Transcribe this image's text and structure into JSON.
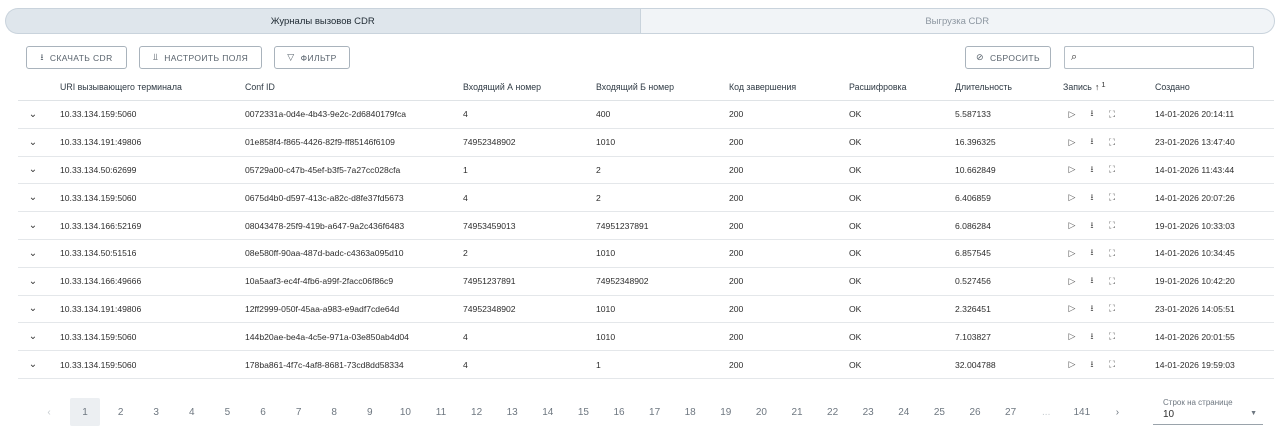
{
  "tabs": [
    {
      "label": "Журналы вызовов CDR",
      "active": true
    },
    {
      "label": "Выгрузка CDR",
      "active": false
    }
  ],
  "toolbar": {
    "download": {
      "label": "СКАЧАТЬ CDR",
      "icon": "download-icon"
    },
    "configure": {
      "label": "НАСТРОИТЬ ПОЛЯ",
      "icon": "columns-icon"
    },
    "filter": {
      "label": "ФИЛЬТР",
      "icon": "filter-icon"
    },
    "reset": {
      "label": "СБРОСИТЬ",
      "icon": "cancel-icon"
    },
    "search_placeholder": ""
  },
  "columns": {
    "uri": "URI вызывающего терминала",
    "conf": "Conf ID",
    "a": "Входящий А номер",
    "b": "Входящий Б номер",
    "code": "Код завершения",
    "decrypt": "Расшифровка",
    "duration": "Длительность",
    "record": "Запись",
    "record_sort_order": "1",
    "created": "Создано"
  },
  "rows": [
    {
      "uri": "10.33.134.159:5060",
      "conf": "0072331a-0d4e-4b43-9e2c-2d6840179fca",
      "a": "4",
      "b": "400",
      "code": "200",
      "decrypt": "OK",
      "duration": "5.587133",
      "created": "14-01-2026 20:14:11"
    },
    {
      "uri": "10.33.134.191:49806",
      "conf": "01e858f4-f865-4426-82f9-ff85146f6109",
      "a": "74952348902",
      "b": "1010",
      "code": "200",
      "decrypt": "OK",
      "duration": "16.396325",
      "created": "23-01-2026 13:47:40"
    },
    {
      "uri": "10.33.134.50:62699",
      "conf": "05729a00-c47b-45ef-b3f5-7a27cc028cfa",
      "a": "1",
      "b": "2",
      "code": "200",
      "decrypt": "OK",
      "duration": "10.662849",
      "created": "14-01-2026 11:43:44"
    },
    {
      "uri": "10.33.134.159:5060",
      "conf": "0675d4b0-d597-413c-a82c-d8fe37fd5673",
      "a": "4",
      "b": "2",
      "code": "200",
      "decrypt": "OK",
      "duration": "6.406859",
      "created": "14-01-2026 20:07:26"
    },
    {
      "uri": "10.33.134.166:52169",
      "conf": "08043478-25f9-419b-a647-9a2c436f6483",
      "a": "74953459013",
      "b": "74951237891",
      "code": "200",
      "decrypt": "OK",
      "duration": "6.086284",
      "created": "19-01-2026 10:33:03"
    },
    {
      "uri": "10.33.134.50:51516",
      "conf": "08e580ff-90aa-487d-badc-c4363a095d10",
      "a": "2",
      "b": "1010",
      "code": "200",
      "decrypt": "OK",
      "duration": "6.857545",
      "created": "14-01-2026 10:34:45"
    },
    {
      "uri": "10.33.134.166:49666",
      "conf": "10a5aaf3-ec4f-4fb6-a99f-2facc06f86c9",
      "a": "74951237891",
      "b": "74952348902",
      "code": "200",
      "decrypt": "OK",
      "duration": "0.527456",
      "created": "19-01-2026 10:42:20"
    },
    {
      "uri": "10.33.134.191:49806",
      "conf": "12ff2999-050f-45aa-a983-e9adf7cde64d",
      "a": "74952348902",
      "b": "1010",
      "code": "200",
      "decrypt": "OK",
      "duration": "2.326451",
      "created": "23-01-2026 14:05:51"
    },
    {
      "uri": "10.33.134.159:5060",
      "conf": "144b20ae-be4a-4c5e-971a-03e850ab4d04",
      "a": "4",
      "b": "1010",
      "code": "200",
      "decrypt": "OK",
      "duration": "7.103827",
      "created": "14-01-2026 20:01:55"
    },
    {
      "uri": "10.33.134.159:5060",
      "conf": "178ba861-4f7c-4af8-8681-73cd8dd58334",
      "a": "4",
      "b": "1",
      "code": "200",
      "decrypt": "OK",
      "duration": "32.004788",
      "created": "14-01-2026 19:59:03"
    }
  ],
  "row_icons": {
    "expand": "chevron-down-icon",
    "play": "play-icon",
    "download": "download-icon",
    "fullscreen": "fullscreen-icon"
  },
  "pagination": {
    "prev": "‹",
    "next": "›",
    "pages": [
      "1",
      "2",
      "3",
      "4",
      "5",
      "6",
      "7",
      "8",
      "9",
      "10",
      "11",
      "12",
      "13",
      "14",
      "15",
      "16",
      "17",
      "18",
      "19",
      "20",
      "21",
      "22",
      "23",
      "24",
      "25",
      "26",
      "27",
      "...",
      "141"
    ],
    "current": "1"
  },
  "rows_per_page": {
    "label": "Строк на странице",
    "value": "10"
  },
  "colors": {
    "tab_active_bg": "#dfe6ec",
    "tab_inactive_bg": "#f1f4f7",
    "border": "#a9b3bc",
    "row_border": "#e4e7ea",
    "page_active_bg": "#eceff2"
  }
}
